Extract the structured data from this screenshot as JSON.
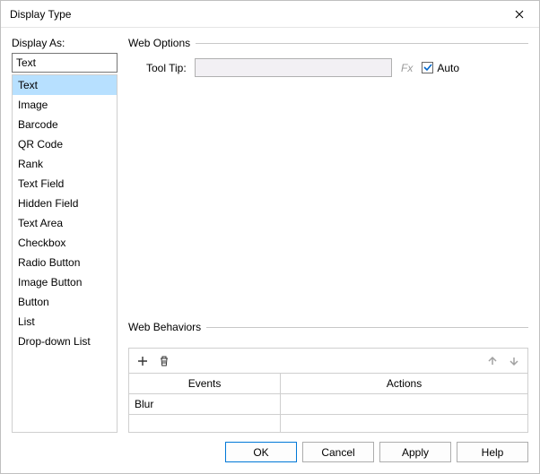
{
  "title": "Display Type",
  "left": {
    "label": "Display As:",
    "value": "Text",
    "items": [
      "Text",
      "Image",
      "Barcode",
      "QR Code",
      "Rank",
      "Text Field",
      "Hidden Field",
      "Text Area",
      "Checkbox",
      "Radio Button",
      "Image Button",
      "Button",
      "List",
      "Drop-down List"
    ],
    "selectedIndex": 0
  },
  "webOptions": {
    "header": "Web Options",
    "tooltipLabel": "Tool Tip:",
    "tooltipValue": "",
    "fx": "Fx",
    "autoLabel": "Auto",
    "autoChecked": true
  },
  "webBehaviors": {
    "header": "Web Behaviors",
    "cols": [
      "Events",
      "Actions"
    ],
    "rows": [
      {
        "event": "Blur",
        "action": ""
      }
    ]
  },
  "buttons": {
    "ok": "OK",
    "cancel": "Cancel",
    "apply": "Apply",
    "help": "Help"
  }
}
